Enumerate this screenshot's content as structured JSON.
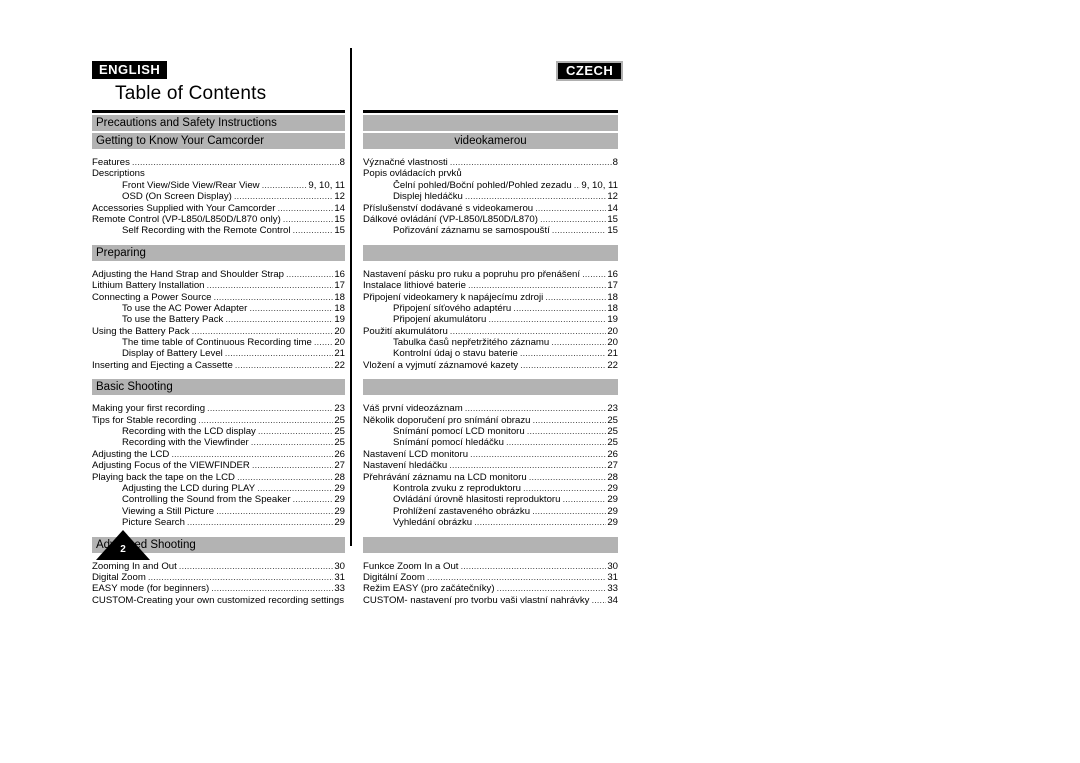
{
  "header": {
    "english_badge": "ENGLISH",
    "czech_badge": "CZECH",
    "title": "Table of Contents"
  },
  "page_marker": {
    "number": "2"
  },
  "columns": {
    "english": {
      "sections": [
        {
          "bar_labels": [
            "Precautions and Safety Instructions",
            "Getting to Know Your Camcorder"
          ],
          "entries": [
            {
              "title": "Features",
              "page": "8",
              "indent": false,
              "dots": true
            },
            {
              "title": "Descriptions",
              "page": "",
              "indent": false,
              "dots": false
            },
            {
              "title": "Front View/Side View/Rear View",
              "page": "9, 10, 11",
              "indent": true,
              "dots": true
            },
            {
              "title": "OSD (On Screen Display)",
              "page": "12",
              "indent": true,
              "dots": true
            },
            {
              "title": "Accessories Supplied with Your Camcorder",
              "page": "14",
              "indent": false,
              "dots": true
            },
            {
              "title": "Remote Control (VP-L850/L850D/L870 only)",
              "page": "15",
              "indent": false,
              "dots": true
            },
            {
              "title": "Self Recording with the Remote Control",
              "page": "15",
              "indent": true,
              "dots": true
            }
          ]
        },
        {
          "bar_labels": [
            "Preparing"
          ],
          "entries": [
            {
              "title": "Adjusting the Hand Strap and Shoulder Strap",
              "page": "16",
              "indent": false,
              "dots": true
            },
            {
              "title": "Lithium Battery Installation",
              "page": "17",
              "indent": false,
              "dots": true
            },
            {
              "title": "Connecting a Power Source",
              "page": "18",
              "indent": false,
              "dots": true
            },
            {
              "title": "To use the AC Power Adapter",
              "page": "18",
              "indent": true,
              "dots": true
            },
            {
              "title": "To use the Battery Pack",
              "page": "19",
              "indent": true,
              "dots": true
            },
            {
              "title": "Using the Battery Pack",
              "page": "20",
              "indent": false,
              "dots": true
            },
            {
              "title": "The time table of Continuous Recording time",
              "page": "20",
              "indent": true,
              "dots": true
            },
            {
              "title": "Display of Battery Level",
              "page": "21",
              "indent": true,
              "dots": true
            },
            {
              "title": "Inserting and Ejecting a Cassette",
              "page": "22",
              "indent": false,
              "dots": true
            }
          ]
        },
        {
          "bar_labels": [
            "Basic Shooting"
          ],
          "entries": [
            {
              "title": "Making your first recording",
              "page": "23",
              "indent": false,
              "dots": true
            },
            {
              "title": "Tips for Stable recording",
              "page": "25",
              "indent": false,
              "dots": true
            },
            {
              "title": "Recording with the LCD display",
              "page": "25",
              "indent": true,
              "dots": true
            },
            {
              "title": "Recording with the Viewfinder",
              "page": "25",
              "indent": true,
              "dots": true
            },
            {
              "title": "Adjusting the LCD",
              "page": "26",
              "indent": false,
              "dots": true
            },
            {
              "title": "Adjusting Focus of the VIEWFINDER",
              "page": "27",
              "indent": false,
              "dots": true
            },
            {
              "title": "Playing back the tape on the LCD",
              "page": "28",
              "indent": false,
              "dots": true
            },
            {
              "title": "Adjusting the LCD during PLAY",
              "page": "29",
              "indent": true,
              "dots": true
            },
            {
              "title": "Controlling the Sound from the Speaker",
              "page": "29",
              "indent": true,
              "dots": true
            },
            {
              "title": "Viewing a Still Picture",
              "page": "29",
              "indent": true,
              "dots": true
            },
            {
              "title": "Picture Search",
              "page": "29",
              "indent": true,
              "dots": true
            }
          ]
        },
        {
          "bar_labels": [
            "Advanced Shooting"
          ],
          "entries": [
            {
              "title": "Zooming In and Out",
              "page": "30",
              "indent": false,
              "dots": true
            },
            {
              "title": "Digital Zoom",
              "page": "31",
              "indent": false,
              "dots": true
            },
            {
              "title": "EASY mode (for beginners)",
              "page": "33",
              "indent": false,
              "dots": true
            },
            {
              "title": "CUSTOM-Creating your own customized recording settings",
              "page": "34",
              "indent": false,
              "dots": true
            }
          ]
        }
      ]
    },
    "czech": {
      "sections": [
        {
          "bar_labels": [
            "",
            "videokamerou"
          ],
          "entries": [
            {
              "title": "Význačné vlastnosti",
              "page": "8",
              "indent": false,
              "dots": true
            },
            {
              "title": "Popis ovládacích prvků",
              "page": "",
              "indent": false,
              "dots": false
            },
            {
              "title": "Čelní pohled/Boční pohled/Pohled zezadu",
              "page": "9, 10, 11",
              "indent": true,
              "dots": true
            },
            {
              "title": "Displej hledáčku",
              "page": "12",
              "indent": true,
              "dots": true
            },
            {
              "title": "Příslušenství dodávané s videokamerou",
              "page": "14",
              "indent": false,
              "dots": true
            },
            {
              "title": "Dálkové ovládání (VP-L850/L850D/L870)",
              "page": "15",
              "indent": false,
              "dots": true
            },
            {
              "title": "Pořizování záznamu se samospouští",
              "page": "15",
              "indent": true,
              "dots": true
            }
          ]
        },
        {
          "bar_labels": [
            ""
          ],
          "entries": [
            {
              "title": "Nastavení pásku pro ruku a popruhu pro přenášení",
              "page": "16",
              "indent": false,
              "dots": true
            },
            {
              "title": "Instalace lithiové baterie",
              "page": "17",
              "indent": false,
              "dots": true
            },
            {
              "title": "Připojení videokamery k napájecímu zdroji",
              "page": "18",
              "indent": false,
              "dots": true
            },
            {
              "title": "Připojení síťového adaptéru",
              "page": "18",
              "indent": true,
              "dots": true
            },
            {
              "title": "Připojení akumulátoru",
              "page": "19",
              "indent": true,
              "dots": true
            },
            {
              "title": "Použití akumulátoru",
              "page": "20",
              "indent": false,
              "dots": true
            },
            {
              "title": "Tabulka časů nepřetržitého záznamu",
              "page": "20",
              "indent": true,
              "dots": true
            },
            {
              "title": "Kontrolní údaj o stavu baterie",
              "page": "21",
              "indent": true,
              "dots": true
            },
            {
              "title": "Vložení a vyjmutí záznamové kazety",
              "page": "22",
              "indent": false,
              "dots": true
            }
          ]
        },
        {
          "bar_labels": [
            ""
          ],
          "entries": [
            {
              "title": "Váš první videozáznam",
              "page": "23",
              "indent": false,
              "dots": true
            },
            {
              "title": "Několik doporučení pro snímání obrazu",
              "page": "25",
              "indent": false,
              "dots": true
            },
            {
              "title": "Snímání pomocí LCD monitoru",
              "page": "25",
              "indent": true,
              "dots": true
            },
            {
              "title": "Snímání pomocí hledáčku",
              "page": "25",
              "indent": true,
              "dots": true
            },
            {
              "title": "Nastavení LCD monitoru",
              "page": "26",
              "indent": false,
              "dots": true
            },
            {
              "title": "Nastavení hledáčku",
              "page": "27",
              "indent": false,
              "dots": true
            },
            {
              "title": "Přehrávání záznamu na LCD monitoru",
              "page": "28",
              "indent": false,
              "dots": true
            },
            {
              "title": "Kontrola zvuku z reproduktoru",
              "page": "29",
              "indent": true,
              "dots": true
            },
            {
              "title": "Ovládání úrovně hlasitosti reproduktoru",
              "page": "29",
              "indent": true,
              "dots": true
            },
            {
              "title": "Prohlížení zastaveného obrázku",
              "page": "29",
              "indent": true,
              "dots": true
            },
            {
              "title": "Vyhledání obrázku",
              "page": "29",
              "indent": true,
              "dots": true
            }
          ]
        },
        {
          "bar_labels": [
            ""
          ],
          "entries": [
            {
              "title": "Funkce Zoom In a Out",
              "page": "30",
              "indent": false,
              "dots": true
            },
            {
              "title": "Digitální Zoom",
              "page": "31",
              "indent": false,
              "dots": true
            },
            {
              "title": "Režim EASY (pro začátečníky)",
              "page": "33",
              "indent": false,
              "dots": true
            },
            {
              "title": "CUSTOM- nastavení pro tvorbu vaši vlastní nahrávky",
              "page": "34",
              "indent": false,
              "dots": true
            }
          ]
        }
      ]
    }
  }
}
